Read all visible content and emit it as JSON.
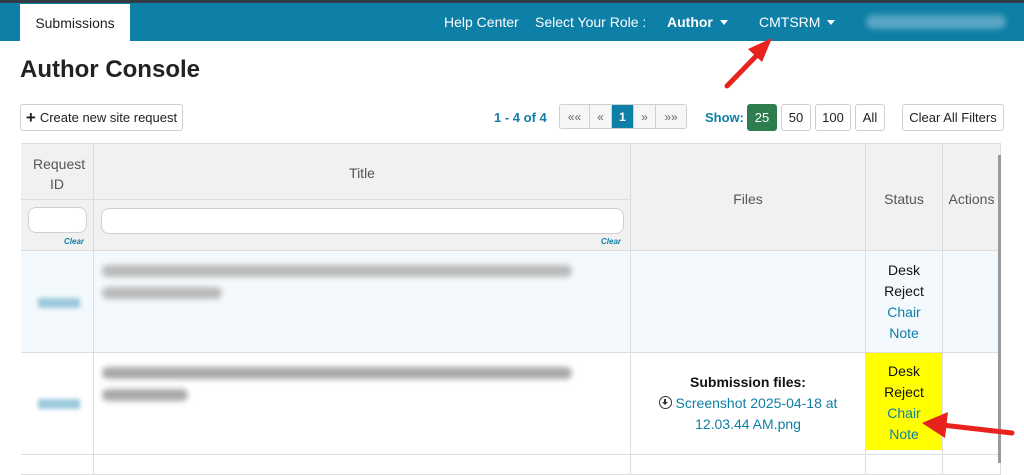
{
  "topbar": {
    "tab": "Submissions",
    "help": "Help Center",
    "role_label": "Select Your Role :",
    "role_value": "Author",
    "conference": "CMTSRM"
  },
  "page": {
    "title": "Author Console"
  },
  "toolbar": {
    "create_label": "Create new site request",
    "range_text": "1 - 4 of 4",
    "pager": [
      "««",
      "«",
      "1",
      "»",
      "»»"
    ],
    "show_label": "Show:",
    "show_options": [
      "25",
      "50",
      "100",
      "All"
    ],
    "show_selected": "25",
    "clear_filters": "Clear All Filters"
  },
  "table": {
    "headers": {
      "request_id": "Request ID",
      "title": "Title",
      "files": "Files",
      "status": "Status",
      "actions": "Actions"
    },
    "clear_link": "Clear",
    "rows": [
      {
        "status_line1": "Desk",
        "status_line2": "Reject",
        "note_line1": "Chair",
        "note_line2": "Note",
        "highlighted": false
      },
      {
        "files_label": "Submission files:",
        "file_line1": "Screenshot 2025-04-18 at",
        "file_line2": "12.03.44 AM.png",
        "status_line1": "Desk",
        "status_line2": "Reject",
        "note_line1": "Chair",
        "note_line2": "Note",
        "highlighted": true
      }
    ]
  },
  "colors": {
    "brand": "#0e7fa6",
    "annotation_arrow": "#e8221d",
    "highlight": "#ffff00",
    "show_active": "#2e7d4f"
  },
  "icons": [
    "caret-down-icon",
    "plus-icon",
    "download-icon",
    "red-arrow-annotation"
  ]
}
